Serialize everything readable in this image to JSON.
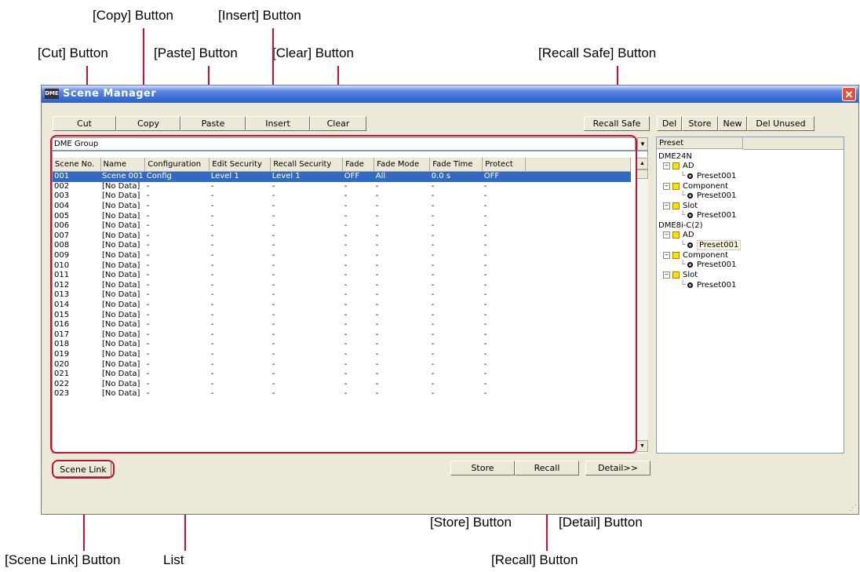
{
  "callouts": {
    "copy": "[Copy] Button",
    "insert": "[Insert] Button",
    "cut": "[Cut] Button",
    "paste": "[Paste] Button",
    "clear": "[Clear] Button",
    "recall_safe": "[Recall Safe] Button",
    "store": "[Store] Button",
    "detail": "[Detail] Button",
    "scene_link": "[Scene Link] Button",
    "list": "List",
    "recall": "[Recall] Button"
  },
  "window": {
    "title": "Scene Manager",
    "icon_text": "DME",
    "close": "✕"
  },
  "toolbar": {
    "cut": "Cut",
    "copy": "Copy",
    "paste": "Paste",
    "insert": "Insert",
    "clear": "Clear",
    "recall_safe": "Recall Safe",
    "del": "Del",
    "store": "Store",
    "new": "New",
    "del_unused": "Del Unused"
  },
  "group_select": {
    "value": "DME Group"
  },
  "table": {
    "headers": [
      "Scene No.",
      "Name",
      "Configuration",
      "Edit Security",
      "Recall Security",
      "Fade",
      "Fade Mode",
      "Fade Time",
      "Protect"
    ],
    "rows": [
      [
        "001",
        "Scene 001",
        "Config",
        "Level 1",
        "Level 1",
        "OFF",
        "All",
        "0.0 s",
        "OFF"
      ],
      [
        "002",
        "[No Data]",
        "-",
        "-",
        "-",
        "-",
        "-",
        "-",
        "-"
      ],
      [
        "003",
        "[No Data]",
        "-",
        "-",
        "-",
        "-",
        "-",
        "-",
        "-"
      ],
      [
        "004",
        "[No Data]",
        "-",
        "-",
        "-",
        "-",
        "-",
        "-",
        "-"
      ],
      [
        "005",
        "[No Data]",
        "-",
        "-",
        "-",
        "-",
        "-",
        "-",
        "-"
      ],
      [
        "006",
        "[No Data]",
        "-",
        "-",
        "-",
        "-",
        "-",
        "-",
        "-"
      ],
      [
        "007",
        "[No Data]",
        "-",
        "-",
        "-",
        "-",
        "-",
        "-",
        "-"
      ],
      [
        "008",
        "[No Data]",
        "-",
        "-",
        "-",
        "-",
        "-",
        "-",
        "-"
      ],
      [
        "009",
        "[No Data]",
        "-",
        "-",
        "-",
        "-",
        "-",
        "-",
        "-"
      ],
      [
        "010",
        "[No Data]",
        "-",
        "-",
        "-",
        "-",
        "-",
        "-",
        "-"
      ],
      [
        "011",
        "[No Data]",
        "-",
        "-",
        "-",
        "-",
        "-",
        "-",
        "-"
      ],
      [
        "012",
        "[No Data]",
        "-",
        "-",
        "-",
        "-",
        "-",
        "-",
        "-"
      ],
      [
        "013",
        "[No Data]",
        "-",
        "-",
        "-",
        "-",
        "-",
        "-",
        "-"
      ],
      [
        "014",
        "[No Data]",
        "-",
        "-",
        "-",
        "-",
        "-",
        "-",
        "-"
      ],
      [
        "015",
        "[No Data]",
        "-",
        "-",
        "-",
        "-",
        "-",
        "-",
        "-"
      ],
      [
        "016",
        "[No Data]",
        "-",
        "-",
        "-",
        "-",
        "-",
        "-",
        "-"
      ],
      [
        "017",
        "[No Data]",
        "-",
        "-",
        "-",
        "-",
        "-",
        "-",
        "-"
      ],
      [
        "018",
        "[No Data]",
        "-",
        "-",
        "-",
        "-",
        "-",
        "-",
        "-"
      ],
      [
        "019",
        "[No Data]",
        "-",
        "-",
        "-",
        "-",
        "-",
        "-",
        "-"
      ],
      [
        "020",
        "[No Data]",
        "-",
        "-",
        "-",
        "-",
        "-",
        "-",
        "-"
      ],
      [
        "021",
        "[No Data]",
        "-",
        "-",
        "-",
        "-",
        "-",
        "-",
        "-"
      ],
      [
        "022",
        "[No Data]",
        "-",
        "-",
        "-",
        "-",
        "-",
        "-",
        "-"
      ],
      [
        "023",
        "[No Data]",
        "-",
        "-",
        "-",
        "-",
        "-",
        "-",
        "-"
      ]
    ]
  },
  "preset_tree": {
    "header": "Preset",
    "nodes": [
      {
        "kind": "device",
        "label": "DME24N"
      },
      {
        "kind": "folder",
        "label": "AD"
      },
      {
        "kind": "preset",
        "label": "Preset001"
      },
      {
        "kind": "folder",
        "label": "Component"
      },
      {
        "kind": "preset",
        "label": "Preset001"
      },
      {
        "kind": "folder",
        "label": "Slot"
      },
      {
        "kind": "preset",
        "label": "Preset001"
      },
      {
        "kind": "device",
        "label": "DME8i-C(2)"
      },
      {
        "kind": "folder",
        "label": "AD"
      },
      {
        "kind": "preset",
        "label": "Preset001",
        "selected": true
      },
      {
        "kind": "folder",
        "label": "Component"
      },
      {
        "kind": "preset",
        "label": "Preset001"
      },
      {
        "kind": "folder",
        "label": "Slot"
      },
      {
        "kind": "preset",
        "label": "Preset001"
      }
    ]
  },
  "bottom": {
    "scene_link": "Scene Link",
    "store": "Store",
    "recall": "Recall",
    "detail": "Detail>>"
  },
  "colors": {
    "annotation": "#c8102e",
    "selection": "#316ac5"
  }
}
